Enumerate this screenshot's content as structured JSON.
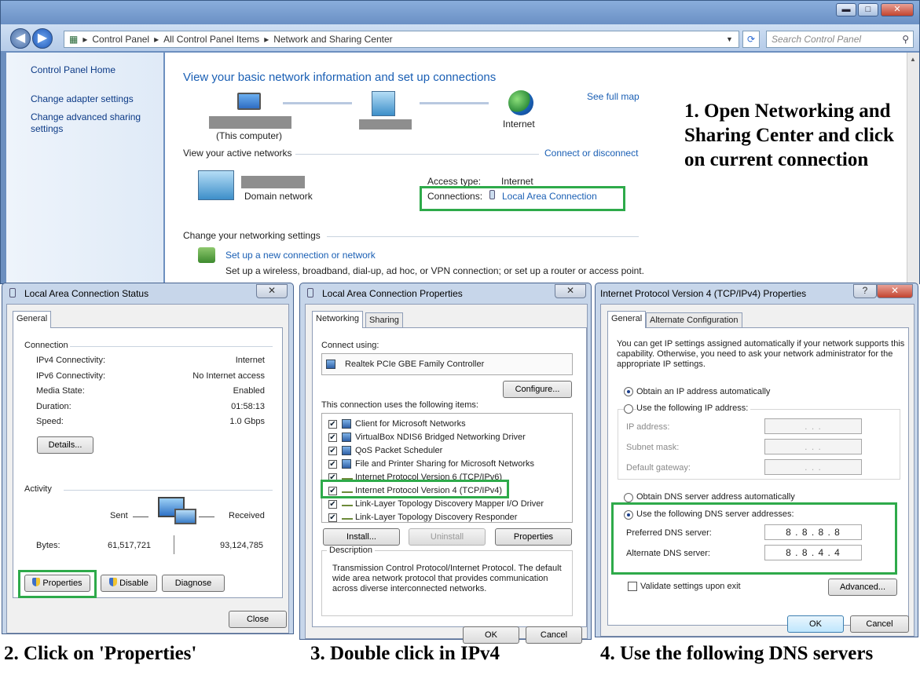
{
  "main_window": {
    "breadcrumb": [
      "Control Panel",
      "All Control Panel Items",
      "Network and Sharing Center"
    ],
    "search_placeholder": "Search Control Panel",
    "caption": {
      "minimize": "▬",
      "maximize": "□",
      "close": "✕"
    },
    "sidebar": {
      "home": "Control Panel Home",
      "links": [
        "Change adapter settings",
        "Change advanced sharing settings"
      ]
    },
    "heading": "View your basic network information and set up connections",
    "see_full_map": "See full map",
    "map": {
      "this_computer": "(This computer)",
      "internet": "Internet"
    },
    "active_networks": {
      "label": "View your active networks",
      "connect_link": "Connect or disconnect",
      "network_type": "Domain network",
      "access_type_label": "Access type:",
      "access_type_value": "Internet",
      "connections_label": "Connections:",
      "connections_value": "Local Area Connection"
    },
    "change_settings": {
      "label": "Change your networking settings",
      "setup_link": "Set up a new connection or network",
      "setup_desc": "Set up a wireless, broadband, dial-up, ad hoc, or VPN connection; or set up a router or access point."
    }
  },
  "status_dialog": {
    "title": "Local Area Connection Status",
    "tab": "General",
    "connection_section": "Connection",
    "rows": [
      {
        "label": "IPv4 Connectivity:",
        "value": "Internet"
      },
      {
        "label": "IPv6 Connectivity:",
        "value": "No Internet access"
      },
      {
        "label": "Media State:",
        "value": "Enabled"
      },
      {
        "label": "Duration:",
        "value": "01:58:13"
      },
      {
        "label": "Speed:",
        "value": "1.0 Gbps"
      }
    ],
    "details_button": "Details...",
    "activity_section": "Activity",
    "sent_label": "Sent",
    "received_label": "Received",
    "bytes_label": "Bytes:",
    "bytes_sent": "61,517,721",
    "bytes_received": "93,124,785",
    "properties_button": "Properties",
    "disable_button": "Disable",
    "diagnose_button": "Diagnose",
    "close_button": "Close"
  },
  "props_dialog": {
    "title": "Local Area Connection Properties",
    "tabs": [
      "Networking",
      "Sharing"
    ],
    "connect_using": "Connect using:",
    "adapter": "Realtek PCIe GBE Family Controller",
    "configure_button": "Configure...",
    "items_label": "This connection uses the following items:",
    "items": [
      "Client for Microsoft Networks",
      "VirtualBox NDIS6 Bridged Networking Driver",
      "QoS Packet Scheduler",
      "File and Printer Sharing for Microsoft Networks",
      "Internet Protocol Version 6 (TCP/IPv6)",
      "Internet Protocol Version 4 (TCP/IPv4)",
      "Link-Layer Topology Discovery Mapper I/O Driver",
      "Link-Layer Topology Discovery Responder"
    ],
    "install_button": "Install...",
    "uninstall_button": "Uninstall",
    "properties_button": "Properties",
    "description_label": "Description",
    "description_text": "Transmission Control Protocol/Internet Protocol. The default wide area network protocol that provides communication across diverse interconnected networks.",
    "ok_button": "OK",
    "cancel_button": "Cancel"
  },
  "ipv4_dialog": {
    "title": "Internet Protocol Version 4 (TCP/IPv4) Properties",
    "tabs": [
      "General",
      "Alternate Configuration"
    ],
    "intro": "You can get IP settings assigned automatically if your network supports this capability. Otherwise, you need to ask your network administrator for the appropriate IP settings.",
    "obtain_ip_auto": "Obtain an IP address automatically",
    "use_following_ip": "Use the following IP address:",
    "ip_address": "IP address:",
    "subnet_mask": "Subnet mask:",
    "default_gateway": "Default gateway:",
    "empty_ip": ".     .     .",
    "obtain_dns_auto": "Obtain DNS server address automatically",
    "use_following_dns": "Use the following DNS server addresses:",
    "preferred_dns_label": "Preferred DNS server:",
    "preferred_dns": "8 . 8 . 8 . 8",
    "alternate_dns_label": "Alternate DNS server:",
    "alternate_dns": "8 . 8 . 4 . 4",
    "validate_label": "Validate settings upon exit",
    "advanced_button": "Advanced...",
    "ok_button": "OK",
    "cancel_button": "Cancel",
    "help": "?"
  },
  "steps": {
    "step1": "1. Open Networking and Sharing Center and click on current connection",
    "step2": "2. Click on 'Properties'",
    "step3": "3. Double click in IPv4",
    "step4": "4. Use the following DNS servers"
  },
  "colors": {
    "highlight": "#2eaa4a",
    "link": "#1a5fb4"
  }
}
